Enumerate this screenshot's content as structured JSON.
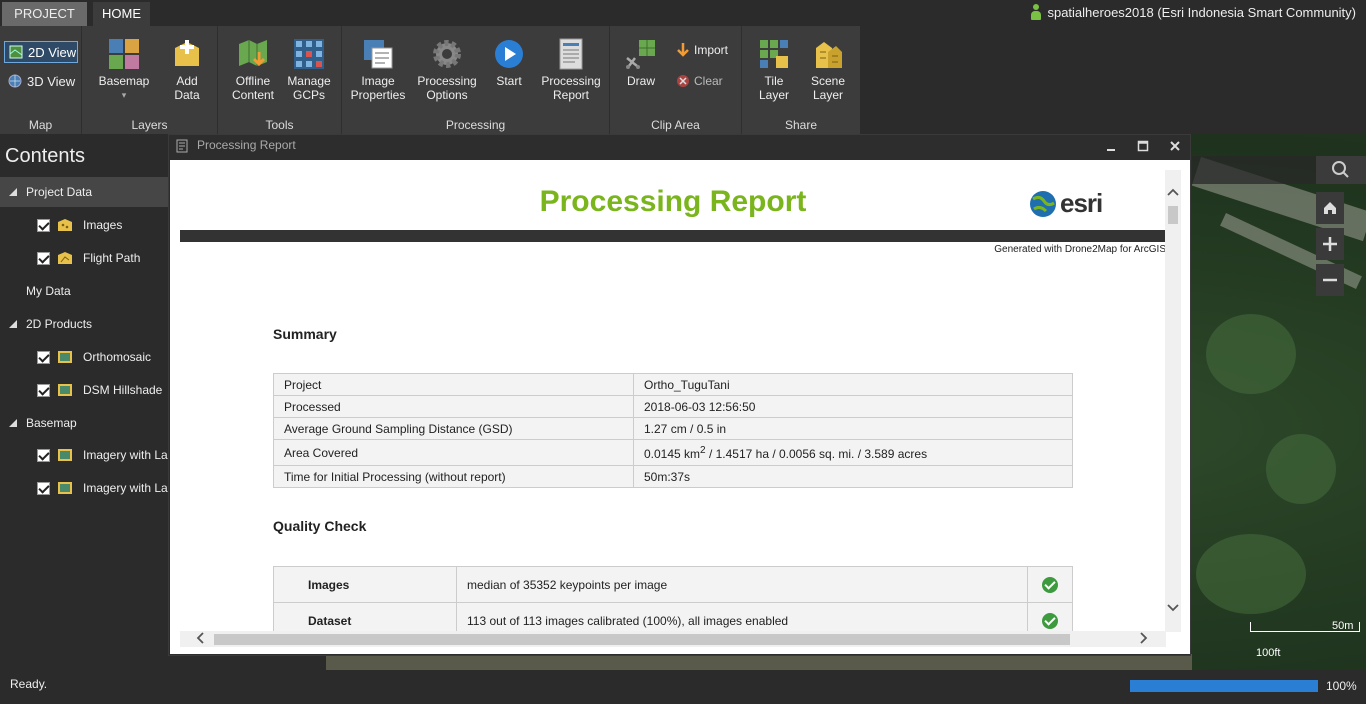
{
  "tabs": {
    "project": "PROJECT",
    "home": "HOME"
  },
  "user": {
    "name": "spatialheroes2018 (Esri Indonesia Smart Community)"
  },
  "ribbon": {
    "map": {
      "label": "Map",
      "view2d": "2D View",
      "view3d": "3D View"
    },
    "layers": {
      "label": "Layers",
      "basemap": "Basemap",
      "add_data": [
        "Add",
        "Data"
      ]
    },
    "tools": {
      "label": "Tools",
      "offline": [
        "Offline",
        "Content"
      ],
      "gcps": [
        "Manage",
        "GCPs"
      ]
    },
    "processing": {
      "label": "Processing",
      "props": [
        "Image",
        "Properties"
      ],
      "options": [
        "Processing",
        "Options"
      ],
      "start": "Start",
      "report": [
        "Processing",
        "Report"
      ]
    },
    "clip": {
      "label": "Clip Area",
      "draw": "Draw",
      "import": "Import",
      "clear": "Clear"
    },
    "share": {
      "label": "Share",
      "tile": [
        "Tile",
        "Layer"
      ],
      "scene": [
        "Scene",
        "Layer"
      ]
    }
  },
  "contents": {
    "title": "Contents",
    "items": [
      {
        "label": "Project Data"
      },
      {
        "label": "Images"
      },
      {
        "label": "Flight Path"
      },
      {
        "label": "My Data"
      },
      {
        "label": "2D Products"
      },
      {
        "label": "Orthomosaic"
      },
      {
        "label": "DSM Hillshade"
      },
      {
        "label": "Basemap"
      },
      {
        "label": "Imagery with La"
      },
      {
        "label": "Imagery with La"
      }
    ]
  },
  "dialog": {
    "title": "Processing Report",
    "report_title": "Processing Report",
    "logo_text": "esri",
    "generated": "Generated with Drone2Map for ArcGIS",
    "summary_heading": "Summary",
    "summary": [
      {
        "k": "Project",
        "v": "Ortho_TuguTani"
      },
      {
        "k": "Processed",
        "v": "2018-06-03 12:56:50"
      },
      {
        "k": "Average Ground Sampling Distance (GSD)",
        "v": "1.27 cm / 0.5 in"
      },
      {
        "k": "Area Covered",
        "v_pre": "0.0145 km",
        "v_sup": "2",
        "v_post": " / 1.4517 ha / 0.0056 sq. mi. / 3.589 acres"
      },
      {
        "k": "Time for Initial Processing (without report)",
        "v": "50m:37s"
      }
    ],
    "quality_heading": "Quality Check",
    "quality": [
      {
        "k": "Images",
        "v": "median of 35352 keypoints per image"
      },
      {
        "k": "Dataset",
        "v": "113 out of 113 images calibrated (100%), all images enabled"
      }
    ]
  },
  "map": {
    "scale_m": "50m",
    "scale_ft": "100ft"
  },
  "status": {
    "text": "Ready.",
    "progress_label": "100%",
    "progress_value": 1.0
  },
  "colors": {
    "accent": "#7ab51d",
    "progress": "#2a7fd4",
    "ribbon": "#3c3c3c"
  }
}
